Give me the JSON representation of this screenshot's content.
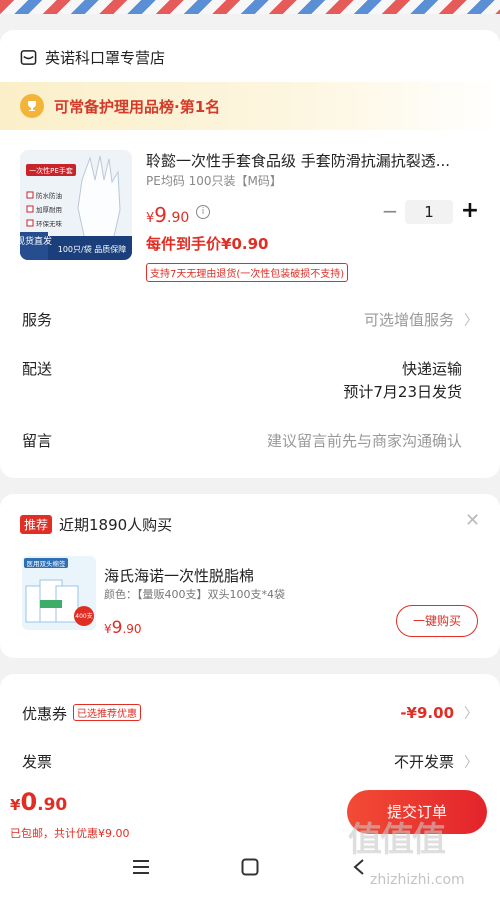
{
  "store": {
    "name": "英诺科口罩专营店",
    "icon": "store-icon"
  },
  "rank_banner": {
    "text": "可常备护理用品榜·第1名",
    "icon": "trophy-icon"
  },
  "product": {
    "title": "聆懿一次性手套食品级 手套防滑抗漏抗裂透...",
    "spec": "PE均码 100只装【M码】",
    "price_yen": "¥",
    "price_int": "9",
    "price_dec": ".90",
    "unit_price": "每件到手价¥0.90",
    "return_policy": "支持7天无理由退货(一次性包装破损不支持)",
    "quantity": "1",
    "minus_label": "−",
    "plus_label": "+",
    "image_banner": "一次性PE手套",
    "image_features": [
      "防水防油",
      "加厚耐用",
      "环保无味"
    ],
    "image_tag": "现货直发",
    "image_footer": "100只/袋 品质保障"
  },
  "details": {
    "service_label": "服务",
    "service_value": "可选增值服务",
    "delivery_label": "配送",
    "delivery_value": "快递运输",
    "delivery_date": "预计7月23日发货",
    "message_label": "留言",
    "message_placeholder": "建议留言前先与商家沟通确认"
  },
  "recommendation": {
    "tag": "推荐",
    "title": "近期1890人购买",
    "item_name": "海氏海诺一次性脱脂棉",
    "item_spec": "颜色：【量贩400支】双头100支*4袋",
    "price_yen": "¥",
    "price_int": "9",
    "price_dec": ".90",
    "buy_label": "一键购买",
    "image_banner": "医用双头棉签",
    "image_badge": "400支"
  },
  "summary": {
    "coupon_label": "优惠券",
    "coupon_tag": "已选推荐优惠",
    "coupon_value": "-¥9.00",
    "invoice_label": "发票",
    "invoice_value": "不开发票"
  },
  "bottom": {
    "total_yen": "¥",
    "total_int": "0",
    "total_dec": ".90",
    "note": "已包邮，共计优惠¥9.00",
    "submit_label": "提交订单"
  },
  "watermark": {
    "main": "值值值",
    "site": "zhizhizhi.com"
  },
  "colors": {
    "accent": "#e02e24",
    "gold": "#f2b53a",
    "background": "#f2f2f2"
  }
}
